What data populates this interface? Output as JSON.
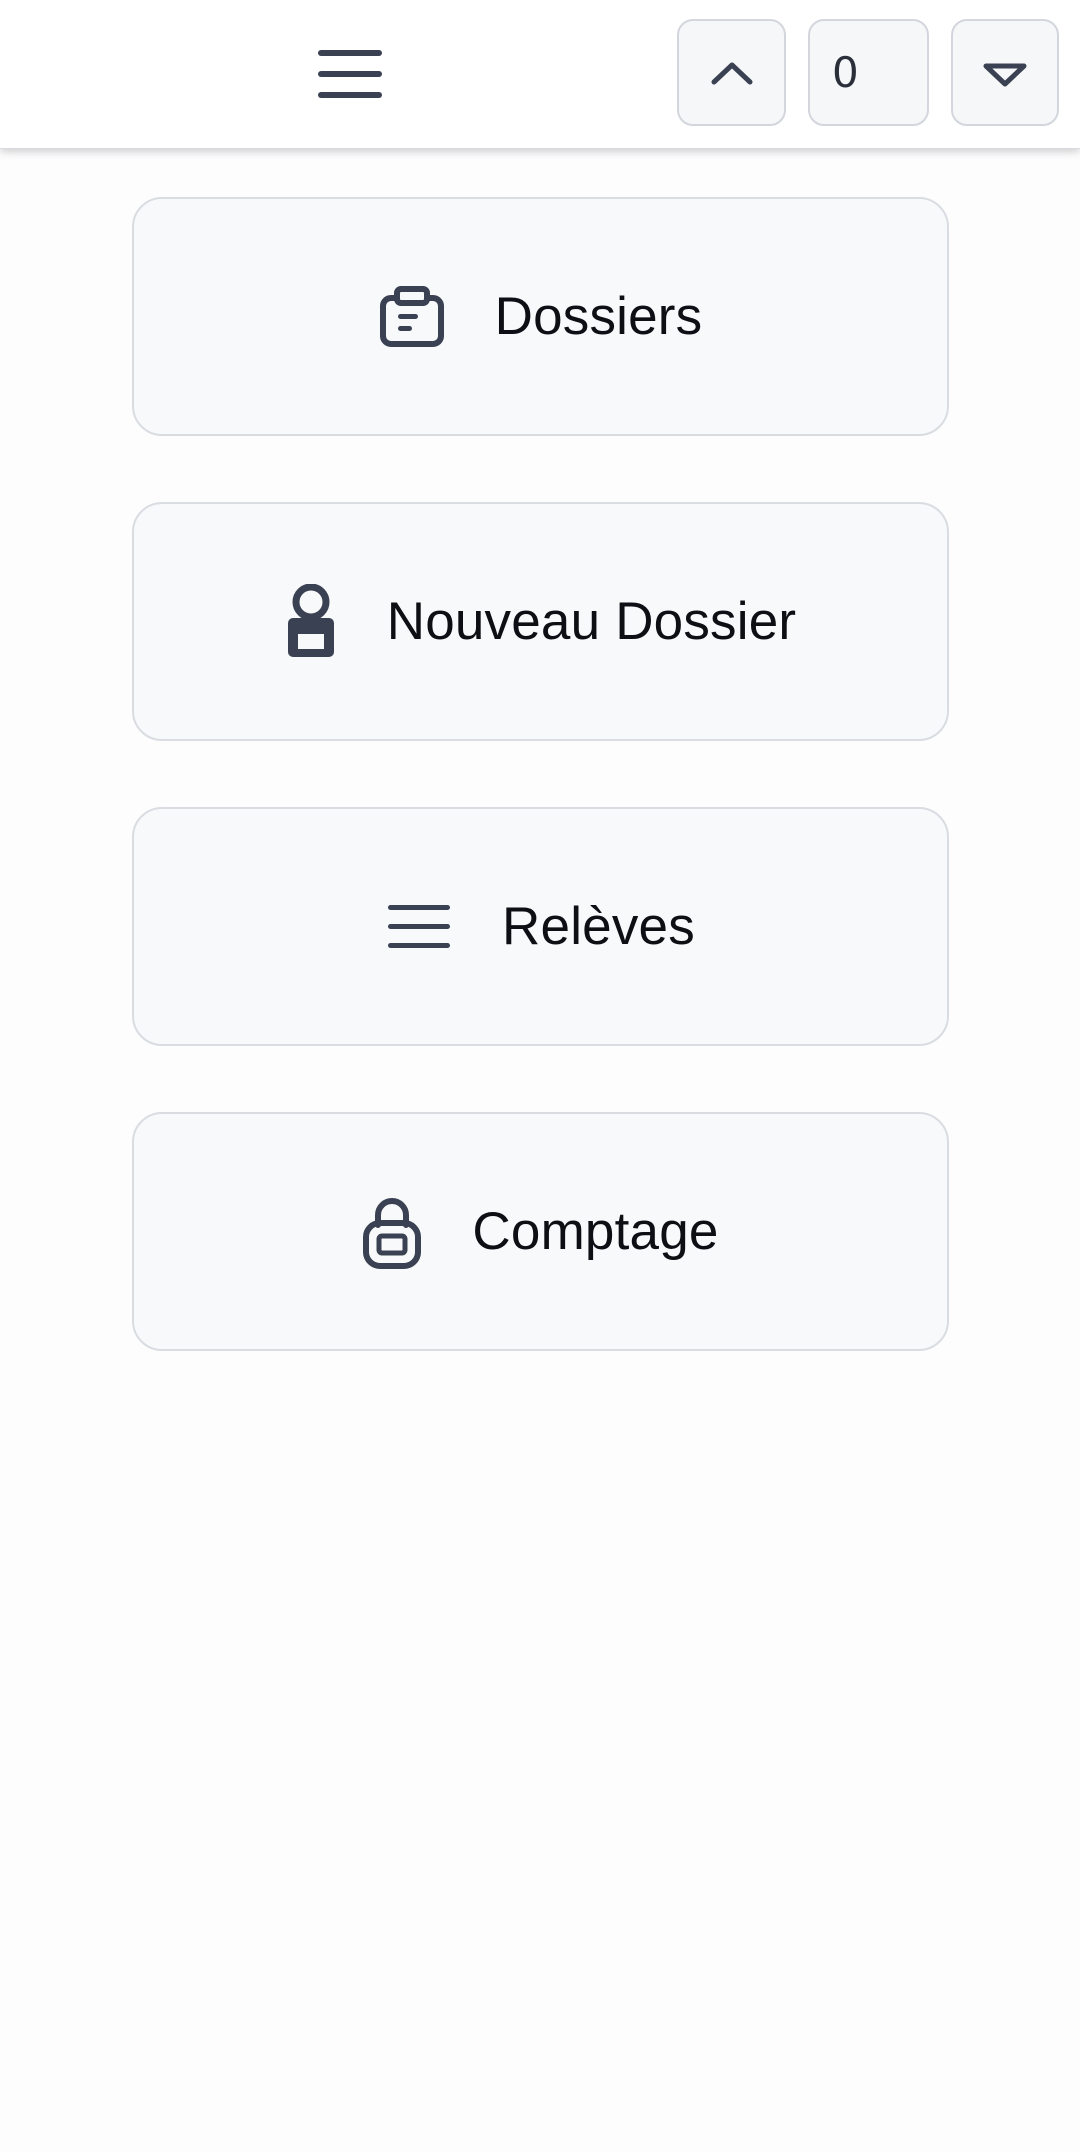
{
  "header": {
    "menu_icon": "hamburger-menu-icon",
    "stepper": {
      "up_icon": "chevron-up-icon",
      "value": "0",
      "down_icon": "triangle-down-icon"
    }
  },
  "menu": {
    "items": [
      {
        "label": "Dossiers",
        "icon": "clipboard-icon"
      },
      {
        "label": "Nouveau Dossier",
        "icon": "person-badge-icon"
      },
      {
        "label": "Relèves",
        "icon": "list-lines-icon"
      },
      {
        "label": "Comptage",
        "icon": "padlock-icon"
      }
    ]
  },
  "colors": {
    "icon": "#3a4152",
    "card_bg": "#f8f9fb",
    "card_border": "#d9dce1",
    "text": "#0d0f14"
  }
}
